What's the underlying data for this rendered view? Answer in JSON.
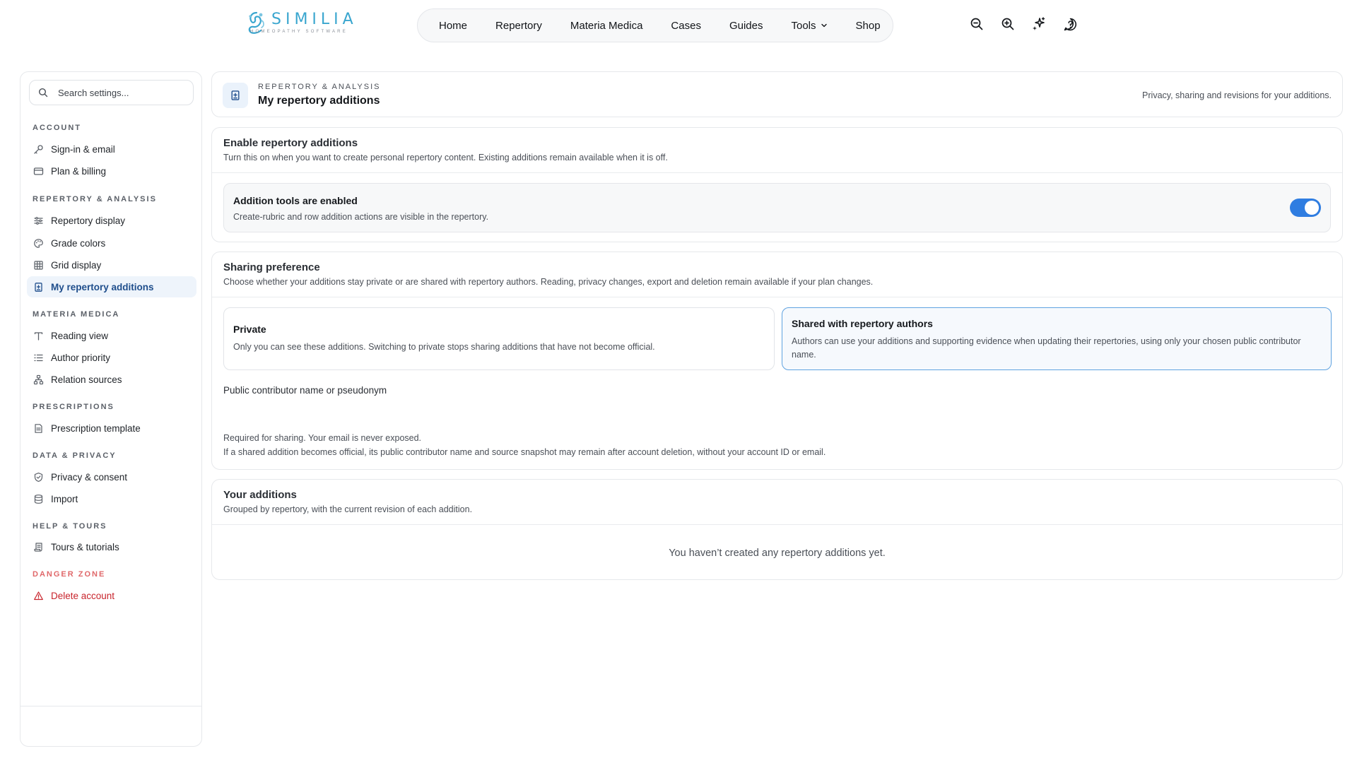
{
  "brand": {
    "name": "SIMILIA",
    "tagline": "HOMEOPATHY SOFTWARE",
    "accent": "#3aa6cf"
  },
  "nav": {
    "items": [
      "Home",
      "Repertory",
      "Materia Medica",
      "Cases",
      "Guides",
      "Tools",
      "Shop"
    ]
  },
  "tool_icons": [
    "zoom-out-icon",
    "zoom-in-icon",
    "sparkle-icon",
    "help-icon"
  ],
  "sidebar": {
    "search_placeholder": "Search settings...",
    "sections": [
      {
        "title": "ACCOUNT",
        "items": [
          {
            "label": "Sign-in & email",
            "icon": "key-icon"
          },
          {
            "label": "Plan & billing",
            "icon": "card-icon"
          }
        ]
      },
      {
        "title": "REPERTORY & ANALYSIS",
        "items": [
          {
            "label": "Repertory display",
            "icon": "sliders-icon"
          },
          {
            "label": "Grade colors",
            "icon": "palette-icon"
          },
          {
            "label": "Grid display",
            "icon": "grid-icon"
          },
          {
            "label": "My repertory additions",
            "icon": "note-plus-icon",
            "active": true
          }
        ]
      },
      {
        "title": "MATERIA MEDICA",
        "items": [
          {
            "label": "Reading view",
            "icon": "text-icon"
          },
          {
            "label": "Author priority",
            "icon": "list-order-icon"
          },
          {
            "label": "Relation sources",
            "icon": "network-icon"
          }
        ]
      },
      {
        "title": "PRESCRIPTIONS",
        "items": [
          {
            "label": "Prescription template",
            "icon": "document-icon"
          }
        ]
      },
      {
        "title": "DATA & PRIVACY",
        "items": [
          {
            "label": "Privacy & consent",
            "icon": "shield-check-icon"
          },
          {
            "label": "Import",
            "icon": "database-icon"
          }
        ]
      },
      {
        "title": "HELP & TOURS",
        "items": [
          {
            "label": "Tours & tutorials",
            "icon": "scroll-icon"
          }
        ]
      },
      {
        "title": "DANGER ZONE",
        "items": [
          {
            "label": "Delete account",
            "icon": "warning-icon"
          }
        ]
      }
    ]
  },
  "page_header": {
    "eyebrow": "REPERTORY & ANALYSIS",
    "title": "My repertory additions",
    "subtitle": "Privacy, sharing and revisions for your additions."
  },
  "enable": {
    "title": "Enable repertory additions",
    "description": "Turn this on when you want to create personal repertory content. Existing additions remain available when it is off.",
    "toggle_title": "Addition tools are enabled",
    "toggle_description": "Create-rubric and row addition actions are visible in the repertory.",
    "toggle_on": true,
    "toggle_color": "#2f7de1"
  },
  "sharing": {
    "title": "Sharing preference",
    "description": "Choose whether your additions stay private or are shared with repertory authors. Reading, privacy changes, export and deletion remain available if your plan changes.",
    "options": [
      {
        "title": "Private",
        "description": "Only you can see these additions. Switching to private stops sharing additions that have not become official.",
        "selected": false
      },
      {
        "title": "Shared with repertory authors",
        "description": "Authors can use your additions and supporting evidence when updating their repertories, using only your chosen public contributor name.",
        "selected": true
      }
    ],
    "field_label": "Public contributor name or pseudonym",
    "field_value": "",
    "help_1": "Required for sharing. Your email is never exposed.",
    "help_2": "If a shared addition becomes official, its public contributor name and source snapshot may remain after account deletion, without your account ID or email."
  },
  "additions": {
    "title": "Your additions",
    "description": "Grouped by repertory, with the current revision of each addition.",
    "empty_message": "You haven’t created any repertory additions yet."
  }
}
